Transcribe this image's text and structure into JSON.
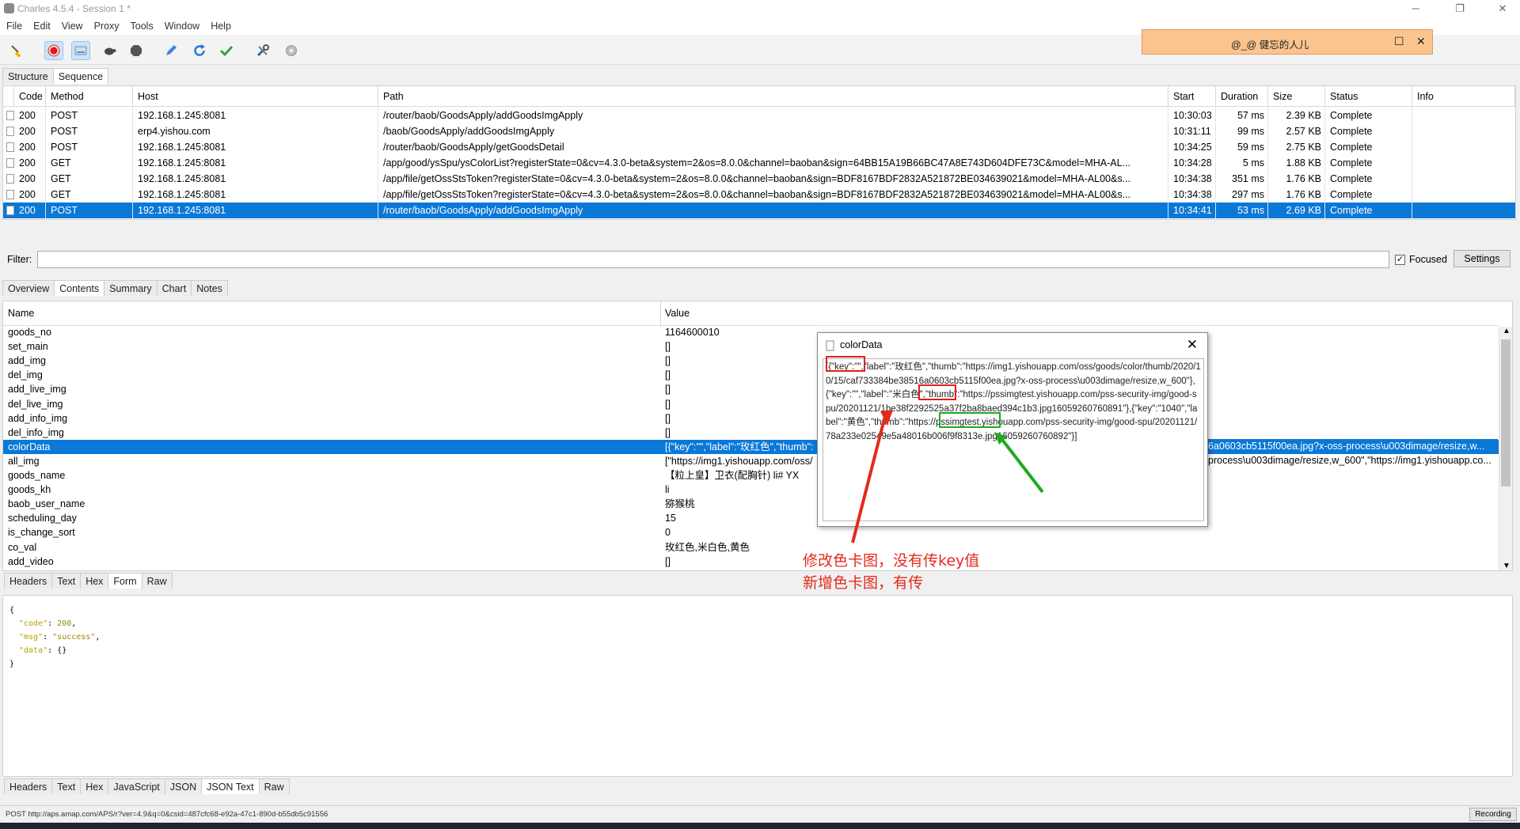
{
  "window": {
    "title": "Charles 4.5.4 - Session 1 *"
  },
  "menu": [
    "File",
    "Edit",
    "View",
    "Proxy",
    "Tools",
    "Window",
    "Help"
  ],
  "toolbar_icons": [
    "broom-icon",
    "record-icon",
    "throttle-icon",
    "turtle-icon",
    "stop-icon",
    "pen-icon",
    "refresh-icon",
    "check-icon",
    "tools-icon",
    "gear-icon"
  ],
  "notice": {
    "text": "@_@  健忘的人儿"
  },
  "view_tabs": [
    "Structure",
    "Sequence"
  ],
  "sequence": {
    "headers": [
      "Code",
      "Method",
      "Host",
      "Path",
      "Start",
      "Duration",
      "Size",
      "Status",
      "Info"
    ],
    "rows": [
      [
        "200",
        "POST",
        "192.168.1.245:8081",
        "/router/baob/GoodsApply/addGoodsImgApply",
        "10:30:03",
        "57 ms",
        "2.39 KB",
        "Complete"
      ],
      [
        "200",
        "POST",
        "erp4.yishou.com",
        "/baob/GoodsApply/addGoodsImgApply",
        "10:31:11",
        "99 ms",
        "2.57 KB",
        "Complete"
      ],
      [
        "200",
        "POST",
        "192.168.1.245:8081",
        "/router/baob/GoodsApply/getGoodsDetail",
        "10:34:25",
        "59 ms",
        "2.75 KB",
        "Complete"
      ],
      [
        "200",
        "GET",
        "192.168.1.245:8081",
        "/app/good/ysSpu/ysColorList?registerState=0&cv=4.3.0-beta&system=2&os=8.0.0&channel=baoban&sign=64BB15A19B66BC47A8E743D604DFE73C&model=MHA-AL...",
        "10:34:28",
        "5 ms",
        "1.88 KB",
        "Complete"
      ],
      [
        "200",
        "GET",
        "192.168.1.245:8081",
        "/app/file/getOssStsToken?registerState=0&cv=4.3.0-beta&system=2&os=8.0.0&channel=baoban&sign=BDF8167BDF2832A521872BE034639021&model=MHA-AL00&s...",
        "10:34:38",
        "351 ms",
        "1.76 KB",
        "Complete"
      ],
      [
        "200",
        "GET",
        "192.168.1.245:8081",
        "/app/file/getOssStsToken?registerState=0&cv=4.3.0-beta&system=2&os=8.0.0&channel=baoban&sign=BDF8167BDF2832A521872BE034639021&model=MHA-AL00&s...",
        "10:34:38",
        "297 ms",
        "1.76 KB",
        "Complete"
      ],
      [
        "200",
        "POST",
        "192.168.1.245:8081",
        "/router/baob/GoodsApply/addGoodsImgApply",
        "10:34:41",
        "53 ms",
        "2.69 KB",
        "Complete"
      ]
    ]
  },
  "filter": {
    "label": "Filter:",
    "focused_label": "Focused",
    "settings_label": "Settings"
  },
  "detail_tabs": [
    "Overview",
    "Contents",
    "Summary",
    "Chart",
    "Notes"
  ],
  "form": {
    "headers": [
      "Name",
      "Value"
    ],
    "rows": [
      [
        "goods_no",
        "1164600010"
      ],
      [
        "set_main",
        "[]"
      ],
      [
        "add_img",
        "[]"
      ],
      [
        "del_img",
        "[]"
      ],
      [
        "add_live_img",
        "[]"
      ],
      [
        "del_live_img",
        "[]"
      ],
      [
        "add_info_img",
        "[]"
      ],
      [
        "del_info_img",
        "[]"
      ],
      [
        "colorData",
        "[{\"key\":\"\",\"label\":\"玫红色\",\"thumb\":"
      ],
      [
        "all_img",
        "[\"https://img1.yishouapp.com/oss/"
      ],
      [
        "goods_name",
        "【粒上皇】卫衣(配胸针)  li#  YX"
      ],
      [
        "goods_kh",
        "li"
      ],
      [
        "baob_user_name",
        "猕猴桃"
      ],
      [
        "scheduling_day",
        "15"
      ],
      [
        "is_change_sort",
        "0"
      ],
      [
        "co_val",
        "玫红色,米白色,黄色"
      ],
      [
        "add_video",
        "[]"
      ]
    ],
    "overflow_color": "6a0603cb5115f00ea.jpg?x-oss-process\\u003dimage/resize,w...",
    "overflow_all": "process\\u003dimage/resize,w_600\",\"https://img1.yishouapp.co..."
  },
  "request_tabs": [
    "Headers",
    "Text",
    "Hex",
    "Form",
    "Raw"
  ],
  "response_json": {
    "code": "200",
    "msg": "\"success\"",
    "data": "{}"
  },
  "response_tabs": [
    "Headers",
    "Text",
    "Hex",
    "JavaScript",
    "JSON",
    "JSON Text",
    "Raw"
  ],
  "status": {
    "text": "POST http://aps.amap.com/APS/r?ver=4.9&q=0&csid=487cfc68-e92a-47c1-890d-b55db5c91556",
    "recording": "Recording"
  },
  "popup": {
    "title": "colorData",
    "text": "[{\"key\":\"\",\"label\":\"玫红色\",\"thumb\":\"https://img1.yishouapp.com/oss/goods/color/thumb/2020/10/15/caf733384be38516a0603cb5115f00ea.jpg?x-oss-process\\u003dimage/resize,w_600\"},{\"key\":\"\",\"label\":\"米白色\",\"thumb\":\"https://pssimgtest.yishouapp.com/pss-security-img/good-spu/20201121/1be38f2292525a37f2ba8baed394c1b3.jpg16059260760891\"},{\"key\":\"1040\",\"label\":\"黄色\",\"thumb\":\"https://pssimgtest.yishouapp.com/pss-security-img/good-spu/20201121/78a233e02549e5a48016b006f9f8313e.jpg16059260760892\"}]"
  },
  "annotations": {
    "line1": "修改色卡图，没有传key值",
    "line2": "新增色卡图，有传"
  },
  "colors": {
    "selection": "#0a78d7",
    "annot_red": "#e52a1c",
    "annot_green": "#1faa1f",
    "notice_bg": "#fbc48f"
  }
}
